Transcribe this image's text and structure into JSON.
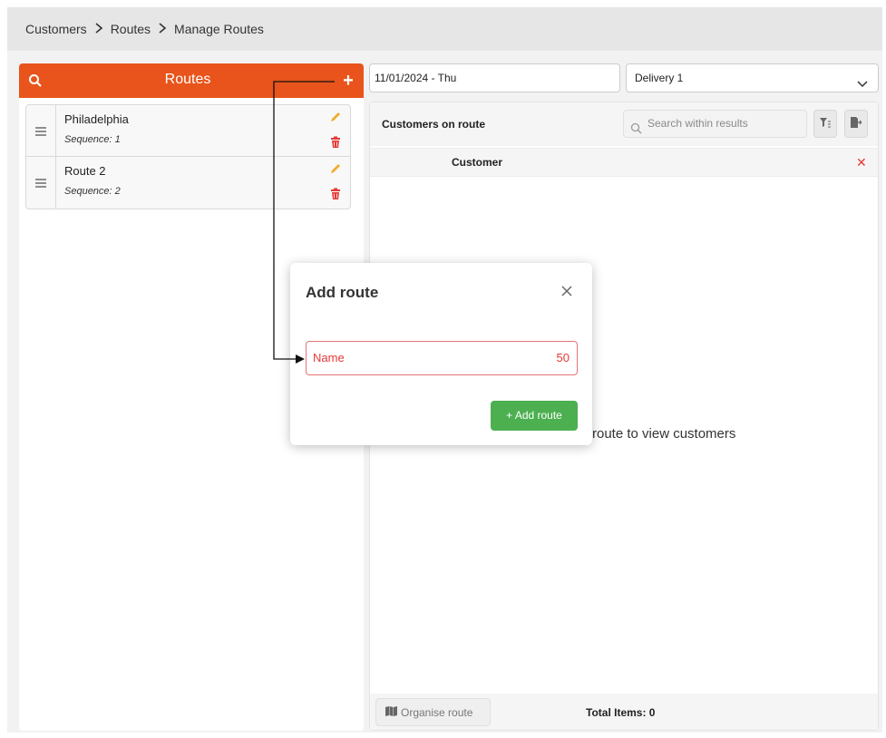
{
  "breadcrumb": {
    "items": [
      "Customers",
      "Routes",
      "Manage Routes"
    ]
  },
  "routes_panel": {
    "title": "Routes",
    "items": [
      {
        "name": "Philadelphia",
        "sequence": "Sequence: 1"
      },
      {
        "name": "Route 2",
        "sequence": "Sequence: 2"
      }
    ]
  },
  "filters": {
    "date": "11/01/2024 - Thu",
    "delivery": "Delivery 1"
  },
  "customers": {
    "title": "Customers on route",
    "search_placeholder": "Search within results",
    "column_customer": "Customer",
    "empty_message": "route to view customers",
    "organise_label": "Organise route",
    "total_label": "Total Items: 0"
  },
  "modal": {
    "title": "Add route",
    "name_placeholder": "Name",
    "name_count": "50",
    "add_button": "+ Add route"
  },
  "colors": {
    "accent": "#e8541b",
    "success": "#4caf50",
    "danger": "#e53935",
    "edit": "#f0ad2c"
  },
  "icons": [
    "search-icon",
    "plus-icon",
    "drag-handle-icon",
    "pencil-icon",
    "trash-icon",
    "chevron-down-icon",
    "filter-icon",
    "export-icon",
    "close-icon",
    "map-icon"
  ]
}
